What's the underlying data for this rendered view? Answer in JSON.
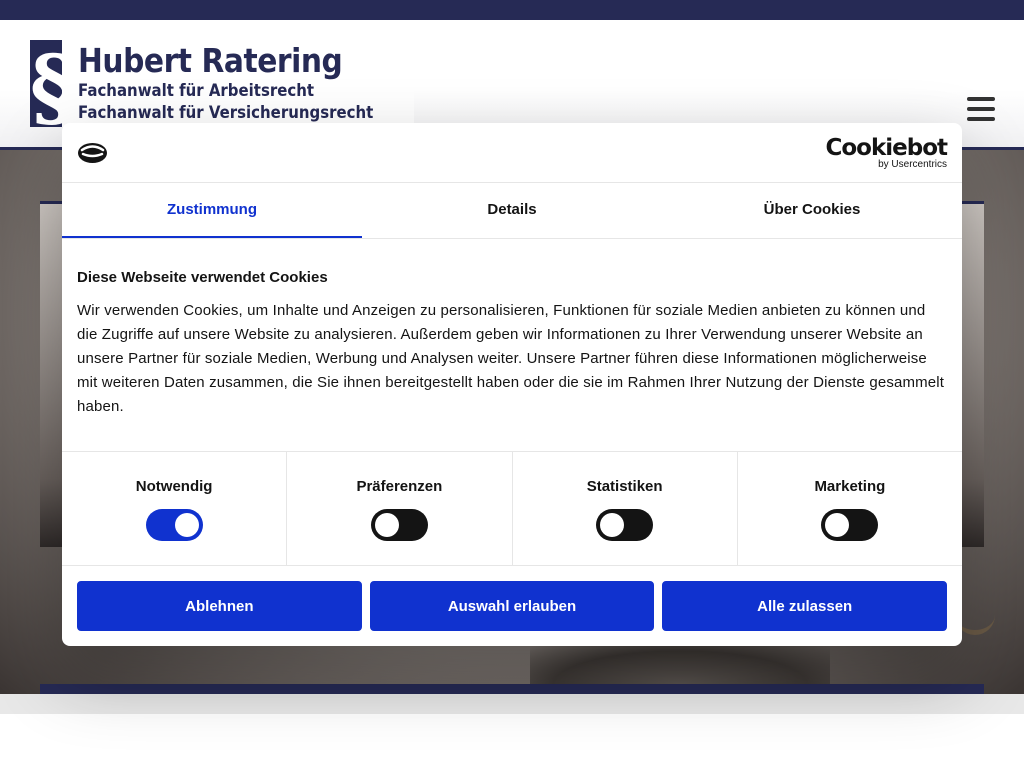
{
  "site": {
    "logo_mark": "§",
    "name": "Hubert Ratering",
    "subtitle_1": "Fachanwalt für Arbeitsrecht",
    "subtitle_2": "Fachanwalt für Versicherungsrecht",
    "menu_icon": "hamburger-menu-icon"
  },
  "colors": {
    "brand_navy": "#262a55",
    "cookiebot_blue": "#1032cf",
    "text": "#141414"
  },
  "cookie_dialog": {
    "brand_name": "Cookiebot",
    "brand_by": "by Usercentrics",
    "tabs": [
      {
        "label": "Zustimmung",
        "active": true
      },
      {
        "label": "Details",
        "active": false
      },
      {
        "label": "Über Cookies",
        "active": false
      }
    ],
    "title": "Diese Webseite verwendet Cookies",
    "text": "Wir verwenden Cookies, um Inhalte und Anzeigen zu personalisieren, Funktionen für soziale Medien anbieten zu können und die Zugriffe auf unsere Website zu analysieren. Außerdem geben wir Informationen zu Ihrer Verwendung unserer Website an unsere Partner für soziale Medien, Werbung und Analysen weiter. Unsere Partner führen diese Informationen möglicherweise mit weiteren Daten zusammen, die Sie ihnen bereitgestellt haben oder die sie im Rahmen Ihrer Nutzung der Dienste gesammelt haben.",
    "categories": [
      {
        "label": "Notwendig",
        "enabled": true
      },
      {
        "label": "Präferenzen",
        "enabled": false
      },
      {
        "label": "Statistiken",
        "enabled": false
      },
      {
        "label": "Marketing",
        "enabled": false
      }
    ],
    "buttons": {
      "decline": "Ablehnen",
      "allow_selection": "Auswahl erlauben",
      "allow_all": "Alle zulassen"
    }
  }
}
